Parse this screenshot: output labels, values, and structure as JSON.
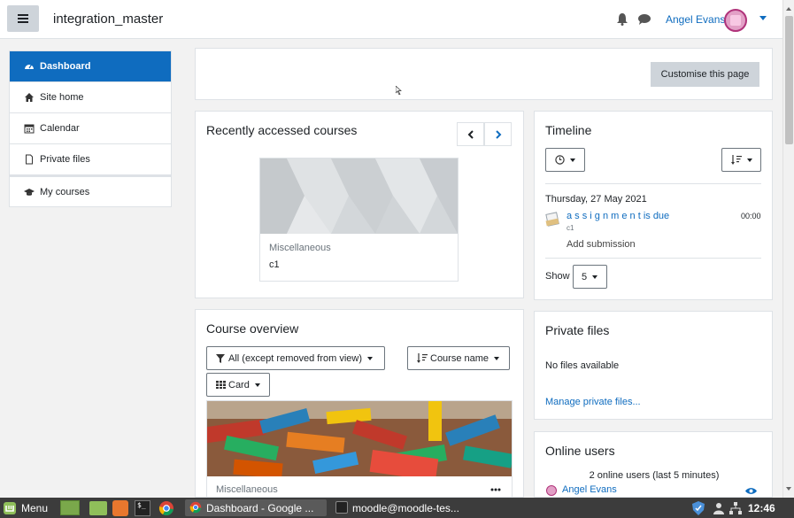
{
  "header": {
    "site_name": "integration_master",
    "username": "Angel Evans",
    "menu_icon": "hamburger-icon",
    "notifications_icon": "bell-icon",
    "messages_icon": "chat-icon"
  },
  "nav": {
    "items": [
      {
        "label": "Dashboard",
        "icon": "dashboard-icon"
      },
      {
        "label": "Site home",
        "icon": "home-icon"
      },
      {
        "label": "Calendar",
        "icon": "calendar-icon"
      },
      {
        "label": "Private files",
        "icon": "file-icon"
      },
      {
        "label": "My courses",
        "icon": "graduation-cap-icon"
      }
    ]
  },
  "main": {
    "customise_label": "Customise this page",
    "recent": {
      "title": "Recently accessed courses",
      "course_category": "Miscellaneous",
      "course_name": "c1"
    },
    "overview": {
      "title": "Course overview",
      "filter_label": "All (except removed from view)",
      "sort_label": "Course name",
      "view_label": "Card",
      "course_category": "Miscellaneous"
    }
  },
  "timeline": {
    "title": "Timeline",
    "date": "Thursday, 27 May 2021",
    "event_name": "a s s i g n m e n t is due",
    "event_course": "c1",
    "event_time": "00:00",
    "event_action": "Add submission",
    "show_label": "Show",
    "show_value": "5"
  },
  "private_files": {
    "title": "Private files",
    "empty_text": "No files available",
    "manage_link": "Manage private files..."
  },
  "online_users": {
    "title": "Online users",
    "summary": "2 online users (last 5 minutes)",
    "user": "Angel Evans"
  },
  "taskbar": {
    "menu_label": "Menu",
    "window_1": "Dashboard - Google ...",
    "window_2": "moodle@moodle-tes...",
    "clock": "12:46"
  },
  "colors": {
    "accent": "#0f6cbf",
    "taskbar": "#3c3c3c",
    "button_secondary": "#ced4da"
  }
}
